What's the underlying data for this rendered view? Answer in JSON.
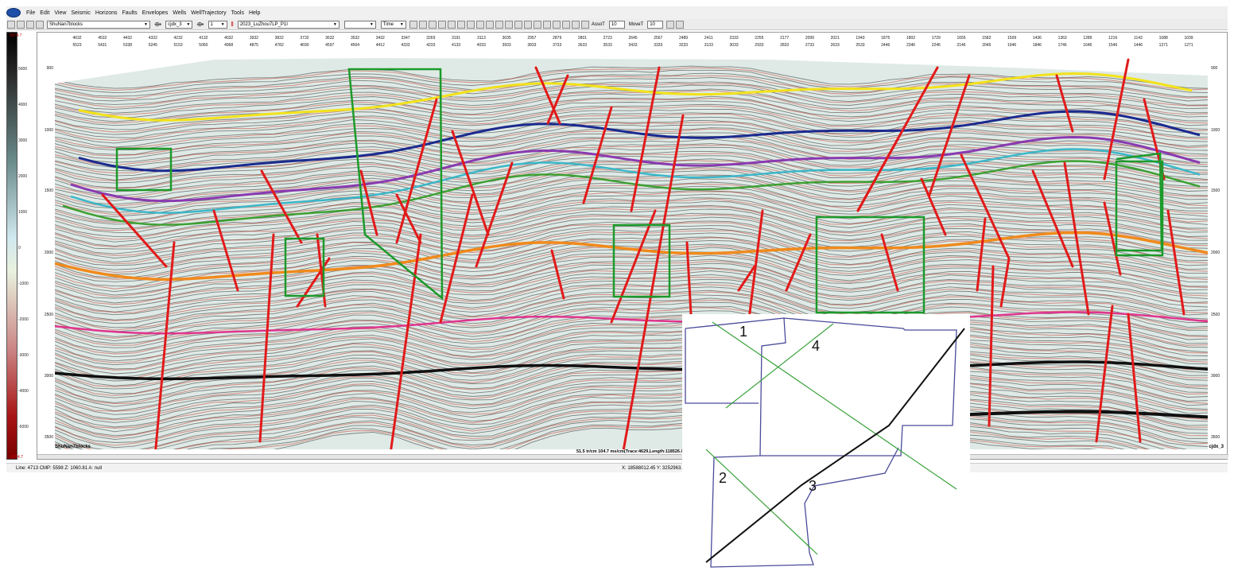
{
  "menu": [
    "File",
    "Edit",
    "View",
    "Seismic",
    "Horizons",
    "Faults",
    "Envelopes",
    "Wells",
    "WellTrajectory",
    "Tools",
    "Help"
  ],
  "toolbar": {
    "project": "ShuNan7blocks",
    "horizon": "cjdx_3",
    "step": "1",
    "line": "2023_LuZhou7LP_P1I",
    "time_mode": "Time",
    "assot_label": "AssoT",
    "assot_value": "10",
    "movet_label": "MoveT",
    "movet_value": "10"
  },
  "colorbar": {
    "max": "5974.7",
    "min": "-5974.7",
    "ticks": [
      "5000",
      "4000",
      "3000",
      "2000",
      "1000",
      "0",
      "-1000",
      "-2000",
      "-3000",
      "-4000",
      "-5000"
    ]
  },
  "axis_top_row1": [
    "4632",
    "4532",
    "4432",
    "4332",
    "4232",
    "4132",
    "4032",
    "3932",
    "3832",
    "3732",
    "3632",
    "3532",
    "3432",
    "3347",
    "3269",
    "3191",
    "3113",
    "3035",
    "2957",
    "2879",
    "2801",
    "2723",
    "2645",
    "2567",
    "2489",
    "2411",
    "2333",
    "2255",
    "2177",
    "2099",
    "2021",
    "1943",
    "1875",
    "1802",
    "1729",
    "1655",
    "1582",
    "1509",
    "1436",
    "1363",
    "1289",
    "1216",
    "1143",
    "1088",
    "1039"
  ],
  "axis_top_row2": [
    "5523",
    "5431",
    "5338",
    "5245",
    "5153",
    "5060",
    "4968",
    "4875",
    "4782",
    "4690",
    "4597",
    "4504",
    "4412",
    "4333",
    "4233",
    "4133",
    "4033",
    "3933",
    "3833",
    "3733",
    "3633",
    "3533",
    "3433",
    "3333",
    "3233",
    "3133",
    "3033",
    "2933",
    "2833",
    "2733",
    "2633",
    "2533",
    "2446",
    "2346",
    "2246",
    "2146",
    "2046",
    "1946",
    "1846",
    "1746",
    "1646",
    "1546",
    "1446",
    "1371",
    "1271"
  ],
  "axis_time": [
    "900",
    "1000",
    "1500",
    "2000",
    "2500",
    "3000",
    "3500"
  ],
  "labels": {
    "project": "ShuNan7blocks",
    "horizon": "cjdx_3",
    "scale": "51.5 tr/cm 104.7 ms/cm(Trace:4629,Length:118526.0)"
  },
  "status": {
    "left": "Line: 4713  CMP: 5598  Z: 1060.81  A: null",
    "right": "X: 18588012.45  Y: 3252963.71"
  },
  "inset": {
    "labels": [
      "1",
      "2",
      "3",
      "4"
    ]
  },
  "colors": {
    "yellow": "#f2e21a",
    "blue": "#1b2a8f",
    "purple": "#8a3ab0",
    "cyan": "#3bb7c9",
    "green": "#3ea033",
    "orange": "#f08a1c",
    "magenta": "#e0358f",
    "black": "#101010",
    "fault": "#e21a1a",
    "box": "#1c9a2a"
  }
}
